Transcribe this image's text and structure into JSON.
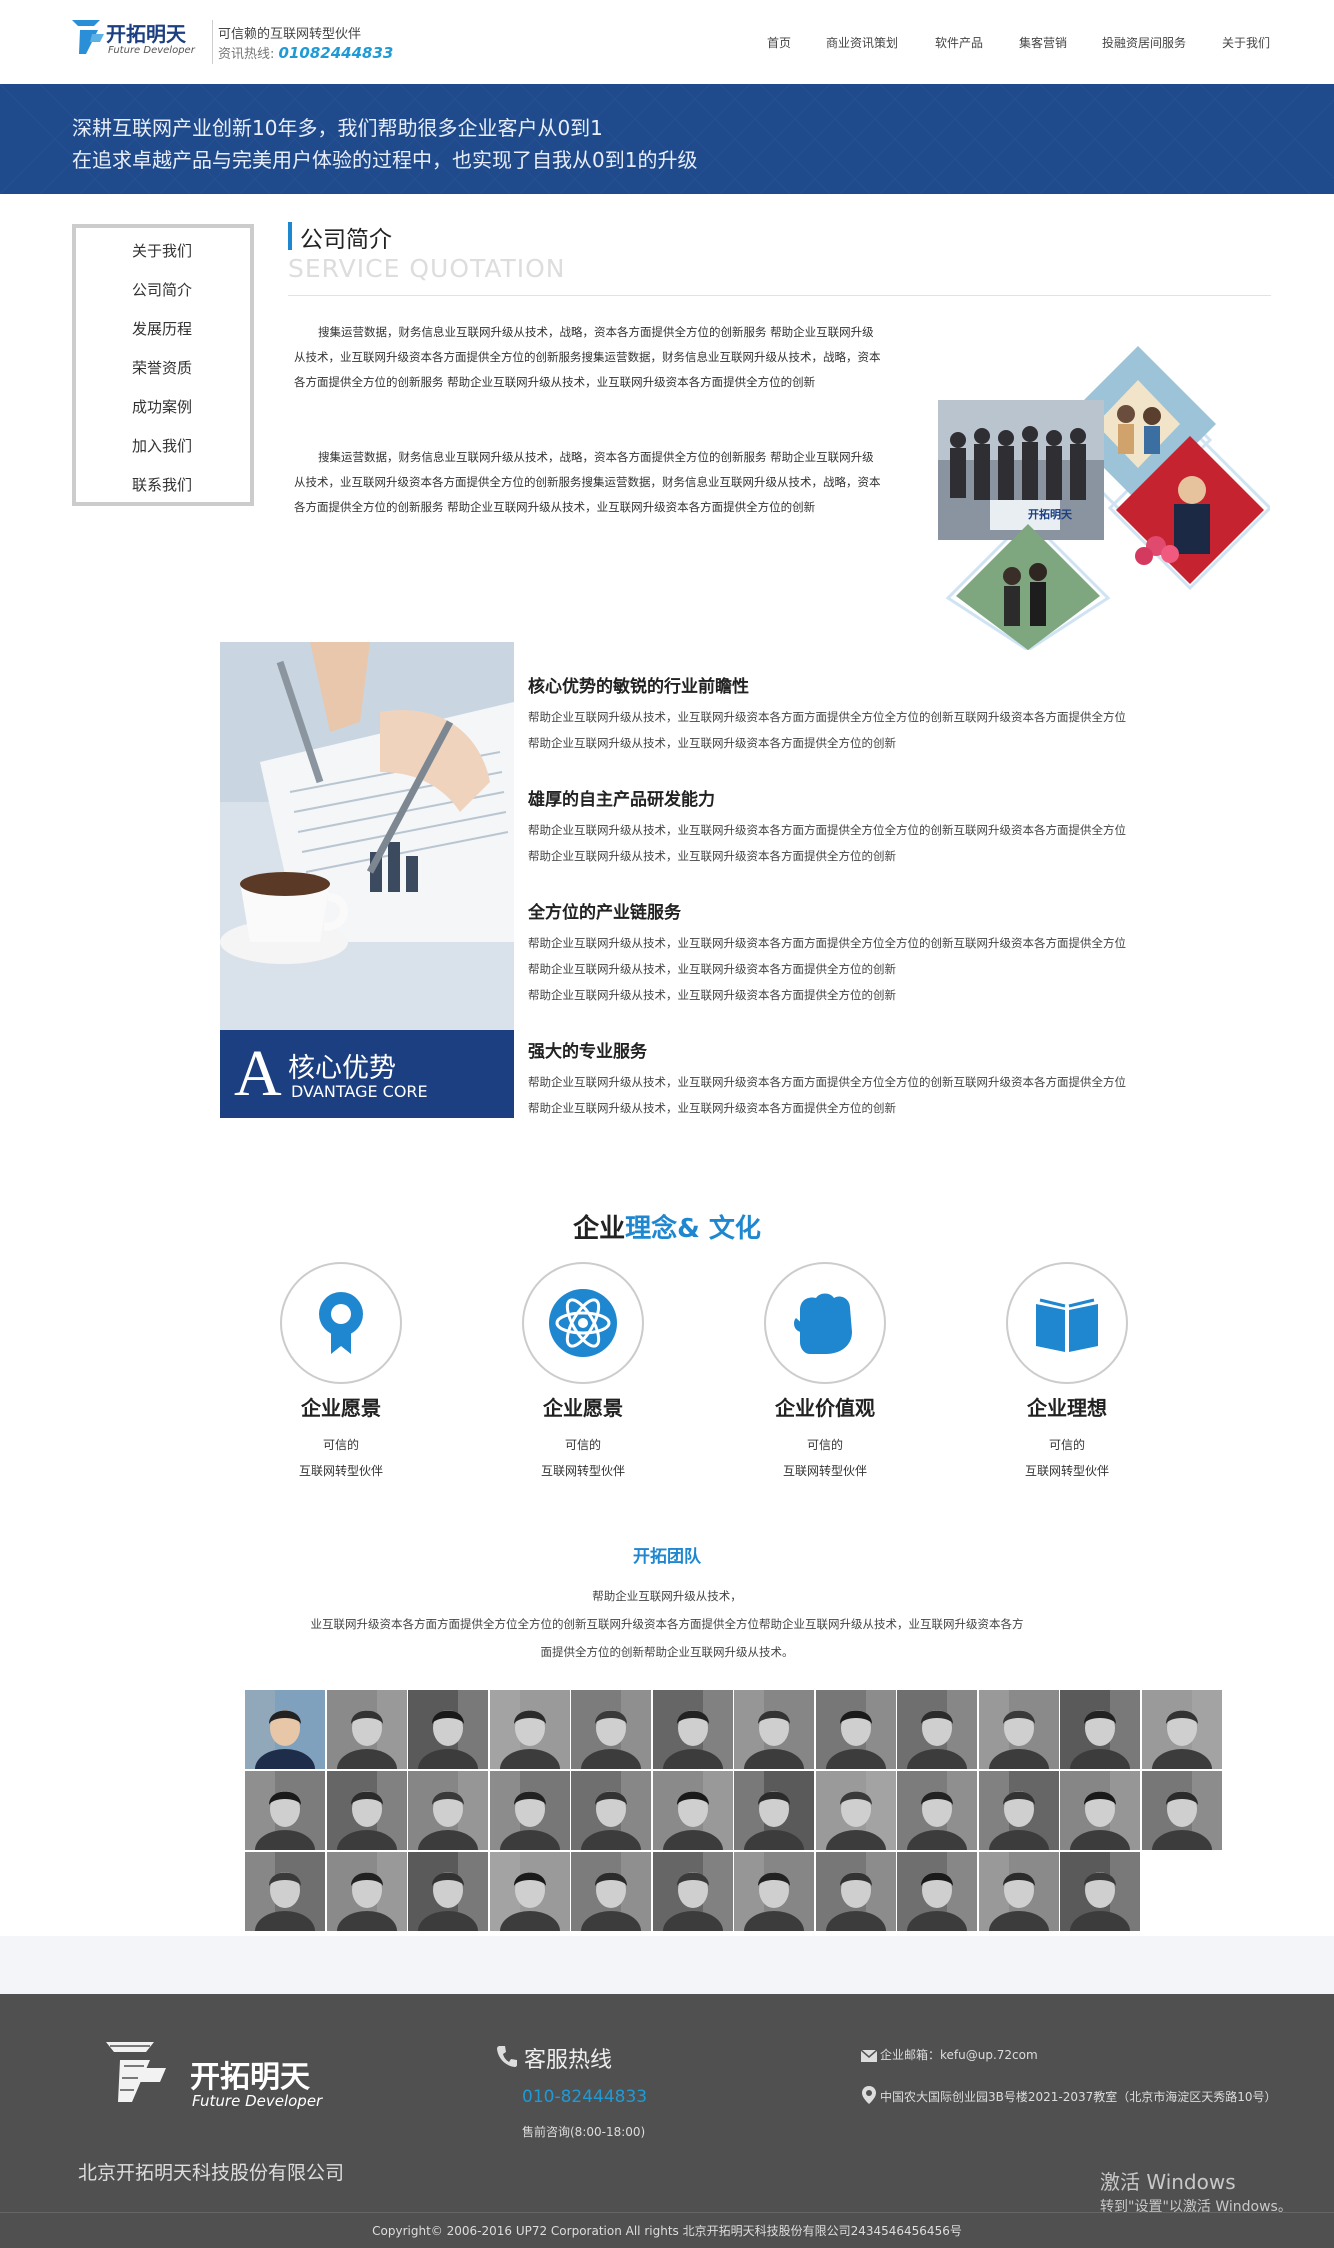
{
  "header": {
    "logo_cn": "开拓明天",
    "logo_en": "Future Developer",
    "slogan": "可信赖的互联网转型伙伴",
    "hotline_label": "资讯热线:",
    "hotline_number": "01082444833",
    "nav": [
      "首页",
      "商业资讯策划",
      "软件产品",
      "集客营销",
      "投融资居间服务",
      "关于我们"
    ]
  },
  "banner": {
    "line1": "深耕互联网产业创新10年多，我们帮助很多企业客户从0到1",
    "line2": "在追求卓越产品与完美用户体验的过程中，也实现了自我从0到1的升级"
  },
  "sidebar": {
    "items": [
      "关于我们",
      "公司简介",
      "发展历程",
      "荣誉资质",
      "成功案例",
      "加入我们",
      "联系我们"
    ]
  },
  "intro": {
    "title": "公司简介",
    "subtitle": "SERVICE QUOTATION",
    "para1": "搜集运营数据，财务信息业互联网升级从技术，战略，资本各方面提供全方位的创新服务 帮助企业互联网升级从技术，业互联网升级资本各方面提供全方位的创新服务搜集运营数据，财务信息业互联网升级从技术，战略，资本各方面提供全方位的创新服务 帮助企业互联网升级从技术，业互联网升级资本各方面提供全方位的创新",
    "para2": "搜集运营数据，财务信息业互联网升级从技术，战略，资本各方面提供全方位的创新服务 帮助企业互联网升级从技术，业互联网升级资本各方面提供全方位的创新服务搜集运营数据，财务信息业互联网升级从技术，战略，资本各方面提供全方位的创新服务 帮助企业互联网升级从技术，业互联网升级资本各方面提供全方位的创新"
  },
  "advantage": {
    "label_letter": "A",
    "label_cn": "核心优势",
    "label_en": "DVANTAGE CORE",
    "items": [
      {
        "title": "核心优势的敏锐的行业前瞻性",
        "lines": [
          "帮助企业互联网升级从技术，业互联网升级资本各方面方面提供全方位全方位的创新互联网升级资本各方面提供全方位",
          "帮助企业互联网升级从技术，业互联网升级资本各方面提供全方位的创新"
        ]
      },
      {
        "title": "雄厚的自主产品研发能力",
        "lines": [
          "帮助企业互联网升级从技术，业互联网升级资本各方面方面提供全方位全方位的创新互联网升级资本各方面提供全方位",
          "帮助企业互联网升级从技术，业互联网升级资本各方面提供全方位的创新"
        ]
      },
      {
        "title": "全方位的产业链服务",
        "lines": [
          "帮助企业互联网升级从技术，业互联网升级资本各方面方面提供全方位全方位的创新互联网升级资本各方面提供全方位",
          "帮助企业互联网升级从技术，业互联网升级资本各方面提供全方位的创新",
          "帮助企业互联网升级从技术，业互联网升级资本各方面提供全方位的创新"
        ]
      },
      {
        "title": "强大的专业服务",
        "lines": [
          "帮助企业互联网升级从技术，业互联网升级资本各方面方面提供全方位全方位的创新互联网升级资本各方面提供全方位",
          "帮助企业互联网升级从技术，业互联网升级资本各方面提供全方位的创新"
        ]
      }
    ]
  },
  "culture": {
    "title_black": "企业",
    "title_blue": "理念& 文化",
    "items": [
      {
        "icon": "award-icon",
        "title": "企业愿景",
        "line1": "可信的",
        "line2": "互联网转型伙伴"
      },
      {
        "icon": "atom-icon",
        "title": "企业愿景",
        "line1": "可信的",
        "line2": "互联网转型伙伴"
      },
      {
        "icon": "fist-icon",
        "title": "企业价值观",
        "line1": "可信的",
        "line2": "互联网转型伙伴"
      },
      {
        "icon": "book-icon",
        "title": "企业理想",
        "line1": "可信的",
        "line2": "互联网转型伙伴"
      }
    ]
  },
  "team": {
    "title": "开拓团队",
    "line1": "帮助企业互联网升级从技术，",
    "line2": "业互联网升级资本各方面方面提供全方位全方位的创新互联网升级资本各方面提供全方位帮助企业互联网升级从技术，业互联网升级资本各方",
    "line3": "面提供全方位的创新帮助企业互联网升级从技术。",
    "photo_rows": [
      12,
      12,
      11
    ]
  },
  "footer": {
    "logo_cn": "开拓明天",
    "logo_en": "Future Developer",
    "company": "北京开拓明天科技股份有限公司",
    "hotline_title": "客服热线",
    "hotline_number": "010-82444833",
    "hours": "售前咨询(8:00-18:00)",
    "email": "企业邮箱：kefu@up.72com",
    "address": "中国农大国际创业园3B号楼2021-2037教室（北京市海淀区天秀路10号）",
    "windows_line1": "激活 Windows",
    "windows_line2": "转到\"设置\"以激活 Windows。",
    "copyright": "Copyright© 2006-2016 UP72 Corporation All rights 北京开拓明天科技股份有限公司2434546456456号"
  },
  "colors": {
    "accent": "#1e87d0",
    "banner": "#1f4a8c",
    "adv_label": "#1b3f80",
    "footer": "#505050"
  }
}
